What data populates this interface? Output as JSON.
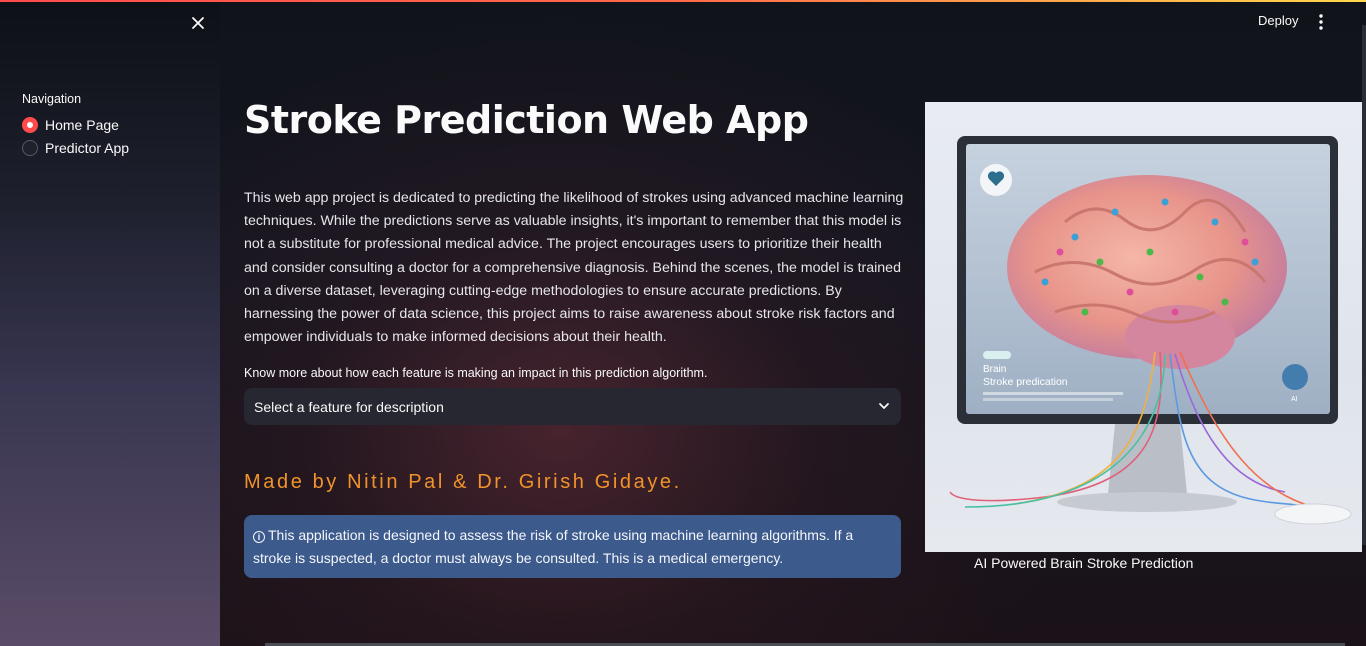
{
  "sidebar": {
    "nav_title": "Navigation",
    "items": [
      {
        "label": "Home Page",
        "selected": true
      },
      {
        "label": "Predictor App",
        "selected": false
      }
    ],
    "close_icon": "close-icon"
  },
  "header": {
    "deploy_label": "Deploy",
    "menu_icon": "vertical-dots-icon"
  },
  "main": {
    "title": "Stroke Prediction Web App",
    "intro": "This web app project is dedicated to predicting the likelihood of strokes using advanced machine learning techniques. While the predictions serve as valuable insights, it's important to remember that this model is not a substitute for professional medical advice. The project encourages users to prioritize their health and consider consulting a doctor for a comprehensive diagnosis. Behind the scenes, the model is trained on a diverse dataset, leveraging cutting-edge methodologies to ensure accurate predictions. By harnessing the power of data science, this project aims to raise awareness about stroke risk factors and empower individuals to make informed decisions about their health.",
    "feature_label": "Know more about how each feature is making an impact in this prediction algorithm.",
    "feature_select": {
      "value": "Select a feature for description"
    },
    "made_by": "Made by Nitin Pal & Dr. Girish Gidaye.",
    "info_text": "This application is designed to assess the risk of stroke using machine learning algorithms. If a stroke is suspected, a doctor must always be consulted. This is a medical emergency.",
    "image": {
      "caption": "AI Powered Brain Stroke Prediction",
      "screen_title_line1": "Brain",
      "screen_title_line2": "Stroke predication",
      "screen_badge": "AI"
    }
  },
  "colors": {
    "accent": "#ff4b4b",
    "made_by": "#f0932b",
    "info_box": "#3c5a8c",
    "select_bg": "#262730"
  }
}
